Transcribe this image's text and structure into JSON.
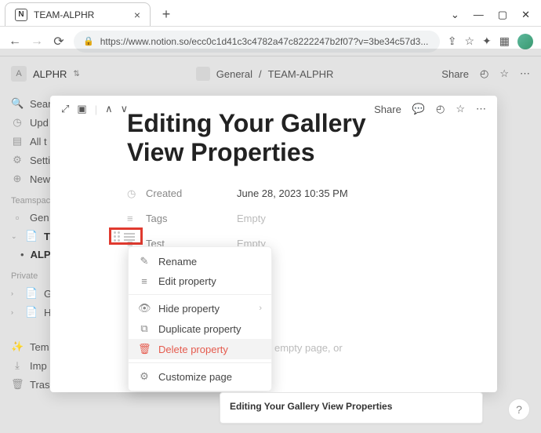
{
  "browser": {
    "tab_title": "TEAM-ALPHR",
    "url": "https://www.notion.so/ecc0c1d41c3c4782a47c8222247b2f07?v=3be34c57d3..."
  },
  "workspace": {
    "name": "ALPHR"
  },
  "breadcrumb": {
    "parent": "General",
    "current": "TEAM-ALPHR"
  },
  "top_actions": {
    "share": "Share"
  },
  "sidebar": {
    "search": "Search",
    "updates": "Upd",
    "all": "All t",
    "settings": "Setti",
    "new": "New",
    "teamspaces_label": "Teamspace",
    "general": "Gen",
    "team": "TEA",
    "alphr": "ALP",
    "private_label": "Private",
    "priv_ge": "Ge",
    "priv_ho": "Ho",
    "templates": "Tem",
    "import": "Imp",
    "trash": "Trasl"
  },
  "modal": {
    "share": "Share",
    "title_line1": "Editing Your Gallery",
    "title_line2": "View Properties",
    "props": {
      "created": {
        "label": "Created",
        "value": "June 28, 2023 10:35 PM"
      },
      "tags": {
        "label": "Tags",
        "value": "Empty"
      },
      "test": {
        "label": "Test",
        "value": "Empty"
      }
    },
    "empty_prompt": "empty page, or"
  },
  "context_menu": {
    "rename": "Rename",
    "edit": "Edit property",
    "hide": "Hide property",
    "duplicate": "Duplicate property",
    "delete": "Delete property",
    "customize": "Customize page"
  },
  "gallery_card": {
    "title": "Editing Your Gallery View Properties"
  }
}
